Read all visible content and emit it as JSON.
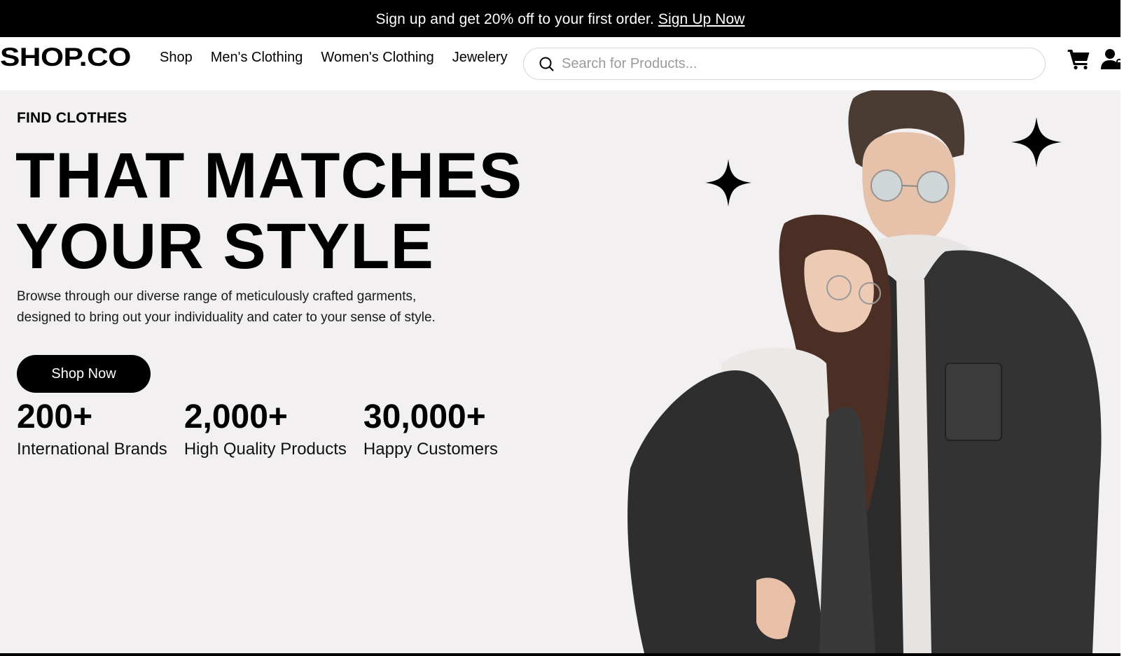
{
  "promo": {
    "text": "Sign up and get 20% off to your first order.",
    "link": "Sign Up Now"
  },
  "nav": {
    "logo": "SHOP.CO",
    "links": [
      "Shop",
      "Men's Clothing",
      "Women's Clothing",
      "Jewelery"
    ],
    "search_placeholder": "Search for Products...",
    "icons": [
      "search-icon",
      "cart-icon",
      "user-icon"
    ]
  },
  "hero": {
    "eyebrow": "FIND CLOTHES",
    "headline_line1": "THAT MATCHES",
    "headline_line2": "YOUR STYLE",
    "description": "Browse through our diverse range of meticulously crafted garments, designed to bring out your individuality and cater to your sense of style.",
    "cta": "Shop Now",
    "stats": [
      {
        "value": "200+",
        "label": "International Brands"
      },
      {
        "value": "2,000+",
        "label": "High Quality Products"
      },
      {
        "value": "30,000+",
        "label": "Happy Customers"
      }
    ]
  },
  "colors": {
    "primary": "#000000",
    "hero_bg": "#f2f0f1",
    "placeholder": "#9a9a9a"
  }
}
